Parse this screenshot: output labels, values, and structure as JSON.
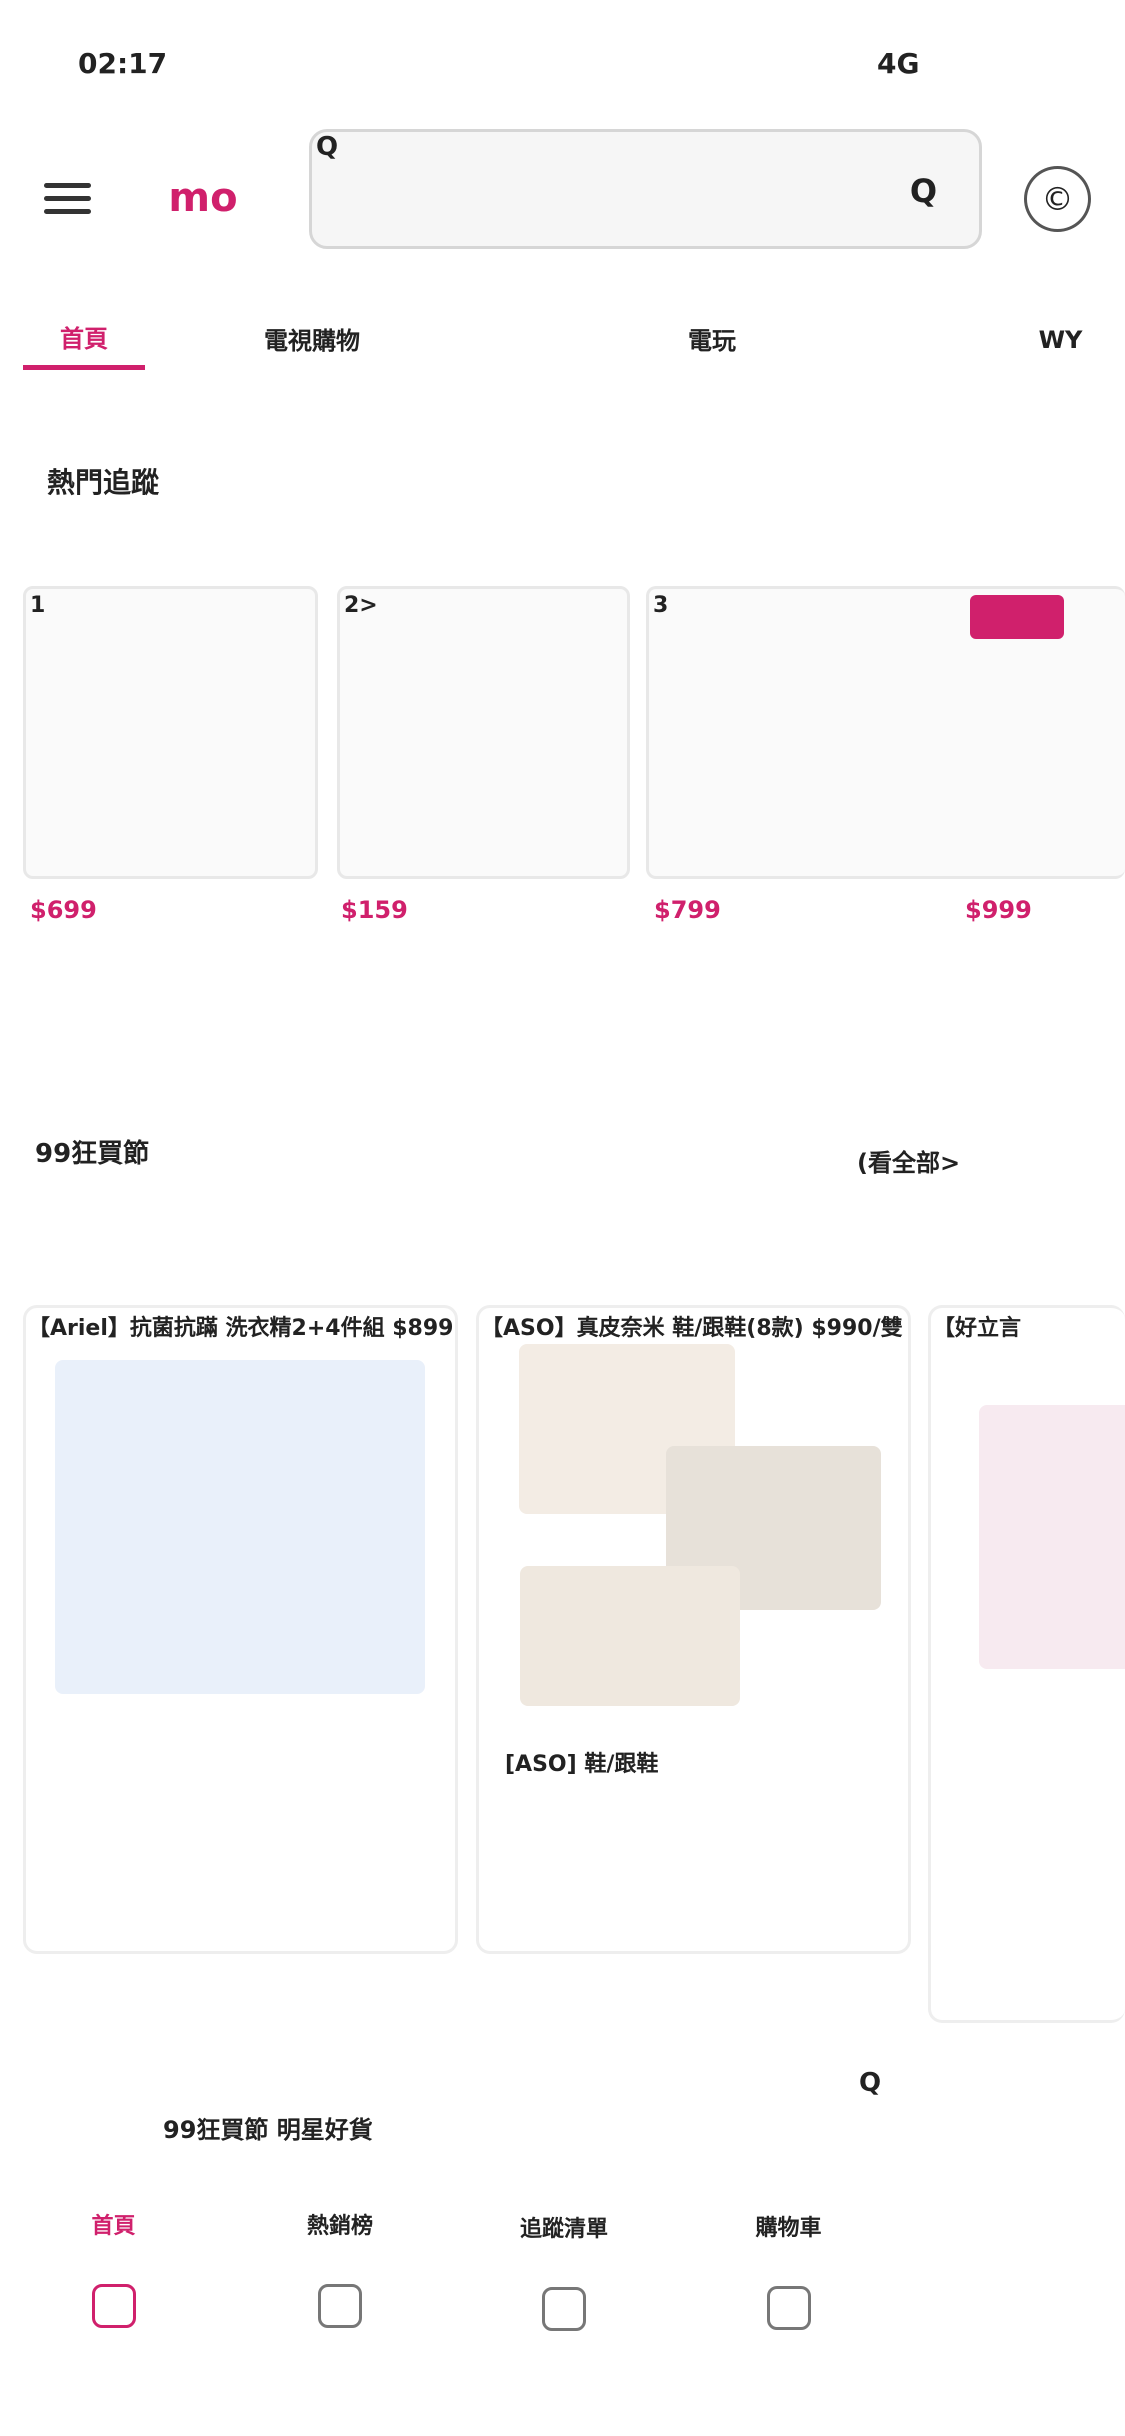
{
  "status_bar": {
    "time": "02:17",
    "network": "4G"
  },
  "header": {
    "logo": "mo",
    "search_icon": "Q",
    "search_button": "Q",
    "account_icon": "©"
  },
  "nav": {
    "tabs": [
      {
        "label": "首頁"
      },
      {
        "label": "電視購物"
      },
      {
        "label": ""
      },
      {
        "label": "電玩"
      }
    ],
    "more": "WY"
  },
  "hot": {
    "title": "熱門追蹤",
    "cards": [
      {
        "rank": "1"
      },
      {
        "rank": "2>"
      },
      {
        "rank": "3"
      }
    ],
    "prices": [
      "$699",
      "$159",
      "$799",
      "$999"
    ]
  },
  "sale": {
    "title": "99狂買節",
    "view_all": "(看全部>",
    "cards": [
      {
        "title": "【Ariel】抗菌抗蹣 洗衣精2+4件組 $899"
      },
      {
        "title": "【ASO】真皮奈米 鞋/跟鞋(8款) $990/雙",
        "caption": "[ASO] 鞋/跟鞋"
      },
      {
        "title": "【好立言"
      }
    ]
  },
  "bottom": {
    "banner": "99狂買節 明星好貨",
    "float_search": "Q",
    "tabs": [
      {
        "label": "首頁"
      },
      {
        "label": "熱銷榜"
      },
      {
        "label": "追蹤清單"
      },
      {
        "label": "購物車"
      }
    ]
  },
  "colors": {
    "accent": "#d0206c"
  }
}
